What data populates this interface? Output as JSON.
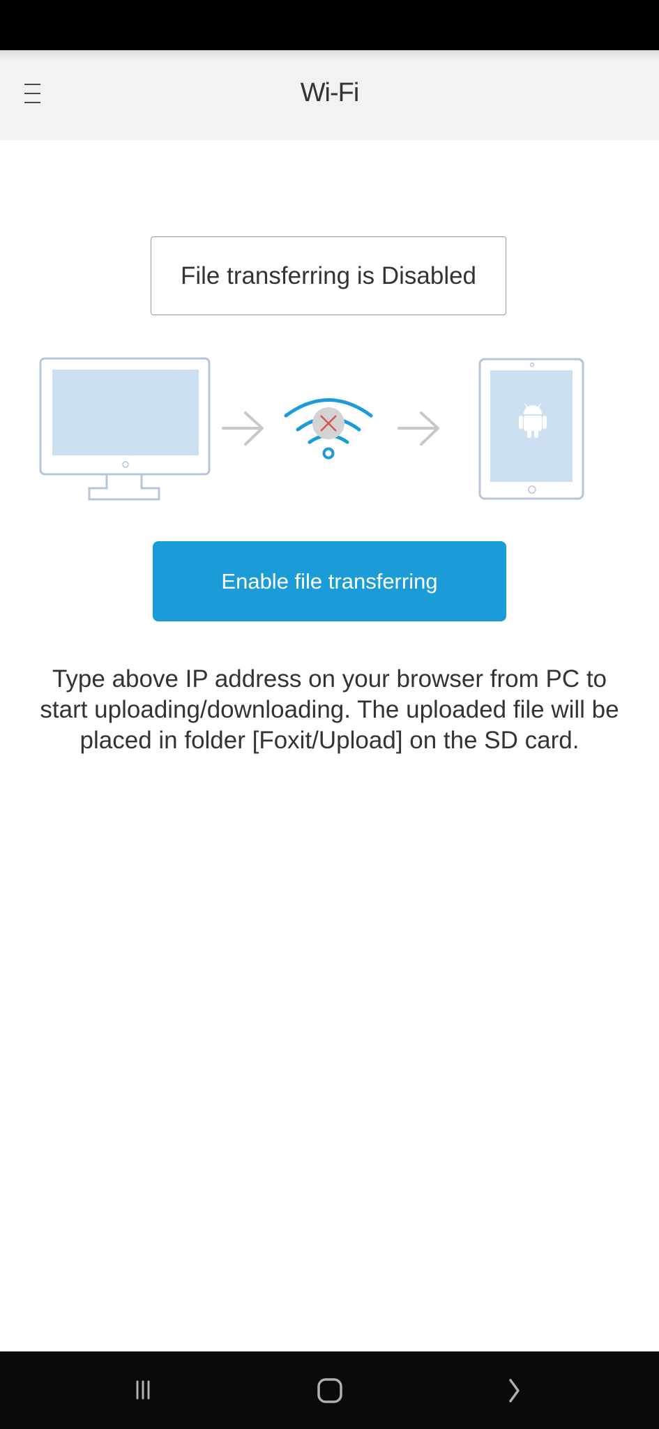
{
  "header": {
    "title": "Wi-Fi",
    "menu_icon": "hamburger-menu-icon"
  },
  "status": {
    "text": "File transferring is Disabled"
  },
  "illustration": {
    "source_device": "desktop-monitor-icon",
    "connection": "wifi-disabled-icon",
    "target_device": "android-tablet-icon",
    "arrow": "arrow-right-icon",
    "colors": {
      "device_outline": "#b3c6dc",
      "device_screen": "#cde0f1",
      "wifi_blue": "#1b9cd8",
      "arrow_gray": "#c8c8c8",
      "x_circle": "#d3d3d3",
      "x_red": "#d9534f"
    }
  },
  "actions": {
    "enable_label": "Enable file transferring",
    "accent_color": "#1b9cd8"
  },
  "help": {
    "text": "Type above IP address on your browser from PC to start uploading/downloading. The uploaded file will be placed in folder [Foxit/Upload] on the SD card."
  },
  "system_nav": {
    "recents": "recents-icon",
    "home": "home-icon",
    "back": "back-icon"
  }
}
